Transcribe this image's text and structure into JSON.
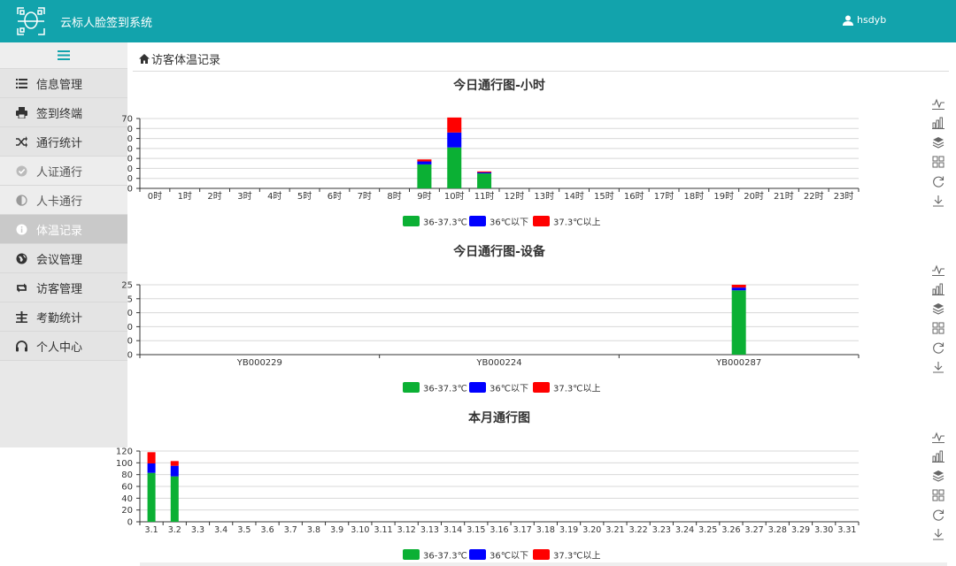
{
  "app": {
    "title": "云标人脸签到系统",
    "username": "hsdyb"
  },
  "sidebar": {
    "items": [
      {
        "label": "信息管理",
        "icon": "list-icon",
        "state": "normal"
      },
      {
        "label": "签到终端",
        "icon": "print-icon",
        "state": "normal"
      },
      {
        "label": "通行统计",
        "icon": "shuffle-icon",
        "state": "normal"
      },
      {
        "label": "人证通行",
        "icon": "check-circle-icon",
        "state": "sub"
      },
      {
        "label": "人卡通行",
        "icon": "half-circle-icon",
        "state": "sub"
      },
      {
        "label": "体温记录",
        "icon": "info-circle-icon",
        "state": "active"
      },
      {
        "label": "会议管理",
        "icon": "globe-icon",
        "state": "normal"
      },
      {
        "label": "访客管理",
        "icon": "retweet-icon",
        "state": "normal"
      },
      {
        "label": "考勤统计",
        "icon": "scale-icon",
        "state": "normal"
      },
      {
        "label": "个人中心",
        "icon": "headphones-icon",
        "state": "normal"
      }
    ]
  },
  "breadcrumb": "访客体温记录",
  "legend": [
    {
      "name": "36-37.3℃",
      "color": "#0bb034"
    },
    {
      "name": "36℃以下",
      "color": "#0000ff"
    },
    {
      "name": "37.3℃以上",
      "color": "#ff0000"
    }
  ],
  "chart_data": [
    {
      "type": "bar",
      "stacked": true,
      "title": "今日通行图-小时",
      "categories": [
        "0时",
        "1时",
        "2时",
        "3时",
        "4时",
        "5时",
        "6时",
        "7时",
        "8时",
        "9时",
        "10时",
        "11时",
        "12时",
        "13时",
        "14时",
        "15时",
        "16时",
        "17时",
        "18时",
        "19时",
        "20时",
        "21时",
        "22时",
        "23时"
      ],
      "series": [
        {
          "name": "36-37.3℃",
          "values": [
            0,
            0,
            0,
            0,
            0,
            0,
            0,
            0,
            0,
            24,
            41,
            15,
            0,
            0,
            0,
            0,
            0,
            0,
            0,
            0,
            0,
            0,
            0,
            0
          ]
        },
        {
          "name": "36℃以下",
          "values": [
            0,
            0,
            0,
            0,
            0,
            0,
            0,
            0,
            0,
            3,
            15,
            1,
            0,
            0,
            0,
            0,
            0,
            0,
            0,
            0,
            0,
            0,
            0,
            0
          ]
        },
        {
          "name": "37.3℃以上",
          "values": [
            0,
            0,
            0,
            0,
            0,
            0,
            0,
            0,
            0,
            2,
            15,
            1,
            0,
            0,
            0,
            0,
            0,
            0,
            0,
            0,
            0,
            0,
            0,
            0
          ]
        }
      ],
      "yticks": [
        0,
        10,
        20,
        30,
        40,
        50,
        60,
        70
      ],
      "ytick_labels": [
        "0",
        "0",
        "0",
        "0",
        "0",
        "0",
        "0",
        "70"
      ],
      "ylim": [
        0,
        70
      ],
      "grid": true,
      "legend": "bottom"
    },
    {
      "type": "bar",
      "stacked": true,
      "title": "今日通行图-设备",
      "categories": [
        "YB000229",
        "YB000224",
        "YB000287"
      ],
      "series": [
        {
          "name": "36-37.3℃",
          "values": [
            0,
            0,
            230
          ]
        },
        {
          "name": "36℃以下",
          "values": [
            0,
            0,
            10
          ]
        },
        {
          "name": "37.3℃以上",
          "values": [
            0,
            0,
            10
          ]
        }
      ],
      "yticks": [
        0,
        50,
        100,
        150,
        200,
        250
      ],
      "ytick_labels": [
        "0",
        "0",
        "0",
        "0",
        "5",
        "25"
      ],
      "ylim": [
        0,
        250
      ],
      "grid": true,
      "legend": "bottom"
    },
    {
      "type": "bar",
      "stacked": true,
      "title": "本月通行图",
      "categories": [
        "3.1",
        "3.2",
        "3.3",
        "3.4",
        "3.5",
        "3.6",
        "3.7",
        "3.8",
        "3.9",
        "3.10",
        "3.11",
        "3.12",
        "3.13",
        "3.14",
        "3.15",
        "3.16",
        "3.17",
        "3.18",
        "3.19",
        "3.20",
        "3.21",
        "3.22",
        "3.23",
        "3.24",
        "3.25",
        "3.26",
        "3.27",
        "3.28",
        "3.29",
        "3.30",
        "3.31"
      ],
      "series": [
        {
          "name": "36-37.3℃",
          "values": [
            83,
            77,
            0,
            0,
            0,
            0,
            0,
            0,
            0,
            0,
            0,
            0,
            0,
            0,
            0,
            0,
            0,
            0,
            0,
            0,
            0,
            0,
            0,
            0,
            0,
            0,
            0,
            0,
            0,
            0,
            0
          ]
        },
        {
          "name": "36℃以下",
          "values": [
            16,
            18,
            0,
            0,
            0,
            0,
            0,
            0,
            0,
            0,
            0,
            0,
            0,
            0,
            0,
            0,
            0,
            0,
            0,
            0,
            0,
            0,
            0,
            0,
            0,
            0,
            0,
            0,
            0,
            0,
            0
          ]
        },
        {
          "name": "37.3℃以上",
          "values": [
            19,
            8,
            0,
            0,
            0,
            0,
            0,
            0,
            0,
            0,
            0,
            0,
            0,
            0,
            0,
            0,
            0,
            0,
            0,
            0,
            0,
            0,
            0,
            0,
            0,
            0,
            0,
            0,
            0,
            0,
            0
          ]
        }
      ],
      "yticks": [
        0,
        20,
        40,
        60,
        80,
        100,
        120
      ],
      "ytick_labels": [
        "0",
        "20",
        "40",
        "60",
        "80",
        "100",
        "120"
      ],
      "ylim": [
        0,
        120
      ],
      "grid": true,
      "legend": "bottom"
    }
  ],
  "toolbox": [
    "line-chart-icon",
    "bar-chart-icon",
    "stack-icon",
    "tiled-icon",
    "restore-icon",
    "download-icon"
  ]
}
